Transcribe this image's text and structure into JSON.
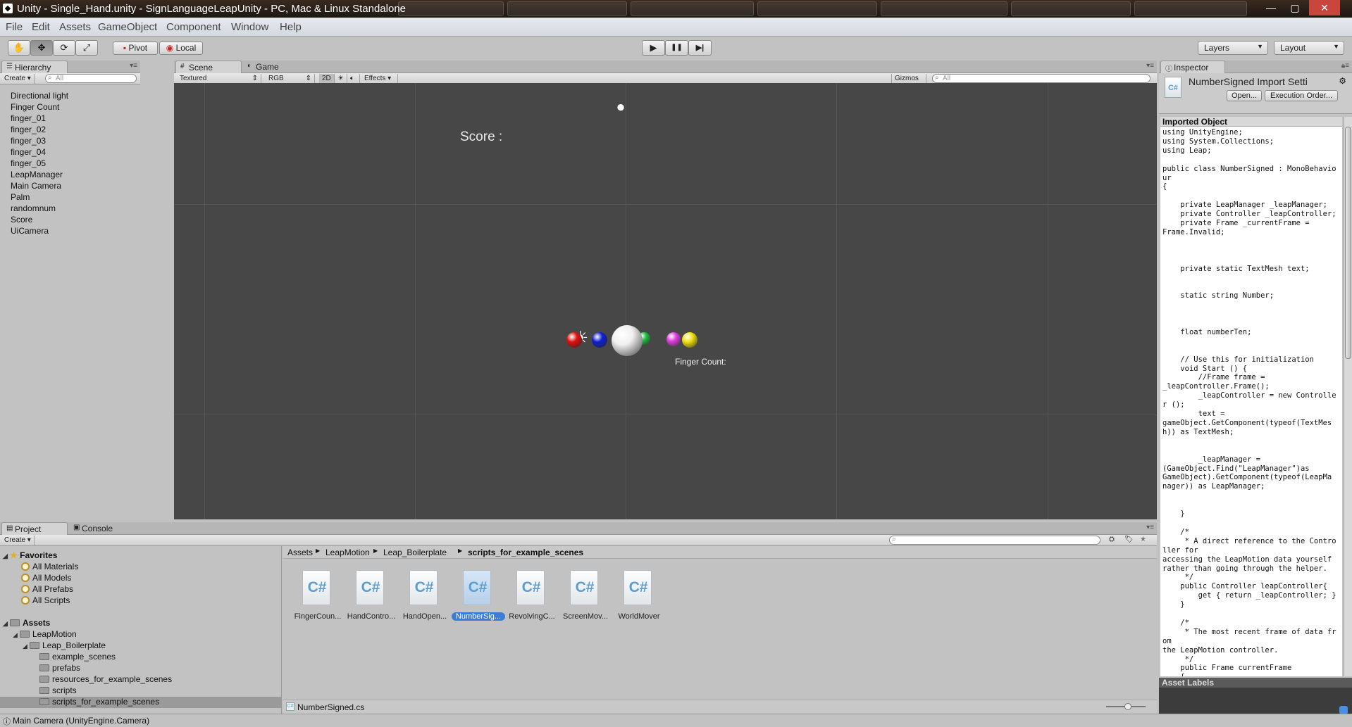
{
  "window": {
    "title": "Unity - Single_Hand.unity - SignLanguageLeapUnity - PC, Mac & Linux Standalone",
    "app_icon": "unity-icon",
    "min_label": "—",
    "max_label": "▢",
    "close_label": "✕"
  },
  "menu": [
    "File",
    "Edit",
    "Assets",
    "GameObject",
    "Component",
    "Window",
    "Help"
  ],
  "toolbar": {
    "tools": [
      "hand-tool-icon",
      "move-tool-icon",
      "rotate-tool-icon",
      "scale-tool-icon"
    ],
    "tool_glyphs": [
      "✋",
      "✥",
      "⟳",
      "⤢"
    ],
    "pivot_label": "Pivot",
    "local_label": "Local",
    "play_glyph": "▶",
    "pause_glyph": "❚❚",
    "step_glyph": "▶|",
    "layers_label": "Layers",
    "layout_label": "Layout"
  },
  "hierarchy": {
    "tab_label": "Hierarchy",
    "create_label": "Create",
    "search_placeholder": "All",
    "items": [
      "Directional light",
      "Finger Count",
      "finger_01",
      "finger_02",
      "finger_03",
      "finger_04",
      "finger_05",
      "LeapManager",
      "Main Camera",
      "Palm",
      "randomnum",
      "Score",
      "UiCamera"
    ]
  },
  "scene": {
    "tab_scene": "Scene",
    "tab_game": "Game",
    "render_mode": "Textured",
    "color_mode": "RGB",
    "mode_2d": "2D",
    "effects_label": "Effects",
    "gizmos_label": "Gizmos",
    "search_placeholder": "All",
    "score_text": "Score :",
    "finger_count_text": "Finger Count:",
    "spheres": [
      {
        "name": "red-sphere",
        "color": "#e01010"
      },
      {
        "name": "blue-sphere",
        "color": "#1020d0"
      },
      {
        "name": "white-sphere",
        "color": "#f0f0f0"
      },
      {
        "name": "green-sphere",
        "color": "#20c040"
      },
      {
        "name": "magenta-sphere",
        "color": "#e040e0"
      },
      {
        "name": "yellow-sphere",
        "color": "#f0e010"
      }
    ]
  },
  "inspector": {
    "tab_label": "Inspector",
    "title": "NumberSigned Import Setti",
    "open_label": "Open...",
    "execution_order_label": "Execution Order...",
    "imported_object_label": "Imported Object",
    "code": "using UnityEngine;\nusing System.Collections;\nusing Leap;\n\npublic class NumberSigned : MonoBehaviour\n{\n\n    private LeapManager _leapManager;\n    private Controller _leapController;\n    private Frame _currentFrame =\nFrame.Invalid;\n\n\n\n    private static TextMesh text;\n\n\n    static string Number;\n\n\n\n    float numberTen;\n\n\n    // Use this for initialization\n    void Start () {\n        //Frame frame =\n_leapController.Frame();\n        _leapController = new Controller ();\n        text =\ngameObject.GetComponent(typeof(TextMes\nh)) as TextMesh;\n\n\n        _leapManager =\n(GameObject.Find(\"LeapManager\")as\nGameObject).GetComponent(typeof(LeapMa\nnager)) as LeapManager;\n\n\n    }\n\n    /*\n     * A direct reference to the Controller for\naccessing the LeapMotion data yourself\nrather than going through the helper.\n     */\n    public Controller leapController{\n        get { return _leapController; }\n    }\n\n    /*\n     * The most recent frame of data from\nthe LeapMotion controller.\n     */\n    public Frame currentFrame\n    {\n        get { return _currentFrame; }\n    }\n\n    public Hand frontmostHand()",
    "asset_labels": "Asset Labels"
  },
  "project": {
    "tab_project": "Project",
    "tab_console": "Console",
    "create_label": "Create",
    "favorites_label": "Favorites",
    "favorites": [
      "All Materials",
      "All Models",
      "All Prefabs",
      "All Scripts"
    ],
    "assets_label": "Assets",
    "leapmotion_label": "LeapMotion",
    "boilerplate_label": "Leap_Boilerplate",
    "subfolders": [
      "example_scenes",
      "prefabs",
      "resources_for_example_scenes",
      "scripts",
      "scripts_for_example_scenes"
    ],
    "breadcrumb": [
      "Assets",
      "LeapMotion",
      "Leap_Boilerplate",
      "scripts_for_example_scenes"
    ],
    "files": [
      "FingerCoun...",
      "HandContro...",
      "HandOpen...",
      "NumberSig...",
      "RevolvingC...",
      "ScreenMov...",
      "WorldMover"
    ],
    "cs_glyph": "C#",
    "selected_file": "NumberSigned.cs"
  },
  "status": {
    "text": "Main Camera (UnityEngine.Camera)"
  }
}
